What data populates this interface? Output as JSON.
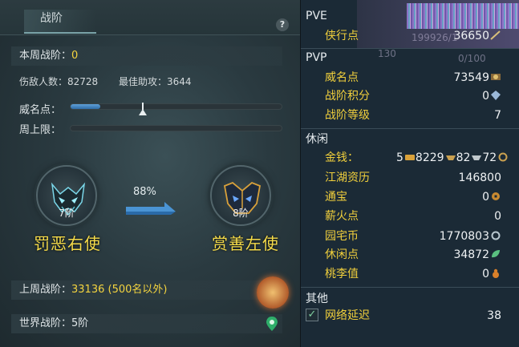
{
  "left": {
    "tab_title": "战阶",
    "help": "?",
    "weekly_label": "本周战阶：",
    "weekly_value": "0",
    "injured_label": "伤敌人数：82728",
    "best_assist_label": "最佳助攻：3644",
    "prestige_label": "威名点：",
    "weekly_cap_label": "周上限：",
    "prestige_progress": 0.14,
    "prestige_marker": 0.34,
    "current_tier": "7阶",
    "current_rank": "罚恶右使",
    "progress_pct": "88%",
    "next_tier": "8阶",
    "next_rank": "赏善左使",
    "last_week_label": "上周战阶：",
    "last_week_value": "33136 (500名以外)",
    "world_label": "世界战阶：5阶"
  },
  "right": {
    "ghost": {
      "a": "199926/1",
      "b": "130",
      "c": "0/100"
    },
    "pve": {
      "title": "PVE",
      "items": [
        {
          "label": "侠行点",
          "value": "36650"
        }
      ]
    },
    "pvp": {
      "title": "PVP",
      "items": [
        {
          "label": "威名点",
          "value": "73549"
        },
        {
          "label": "战阶积分",
          "value": "0"
        },
        {
          "label": "战阶等级",
          "value": "7"
        }
      ]
    },
    "leisure": {
      "title": "休闲",
      "money_label": "金钱：",
      "money_gold": "5",
      "money_silver": "8229",
      "money_copper1": "82",
      "money_copper2": "72",
      "items": [
        {
          "label": "江湖资历",
          "value": "146800"
        },
        {
          "label": "通宝",
          "value": "0"
        },
        {
          "label": "薪火点",
          "value": "0"
        },
        {
          "label": "园宅币",
          "value": "1770803"
        },
        {
          "label": "休闲点",
          "value": "34872"
        },
        {
          "label": "桃李值",
          "value": "0"
        }
      ]
    },
    "other": {
      "title": "其他",
      "network_label": "网络延迟",
      "network_value": "38",
      "network_checked": "✓"
    }
  },
  "colors": {
    "label_gold": "#f0cf3c",
    "rank_gold": "#f6dc4a",
    "weekly_yellow": "#f4d43f",
    "bar_blue": "#3f86c8"
  }
}
